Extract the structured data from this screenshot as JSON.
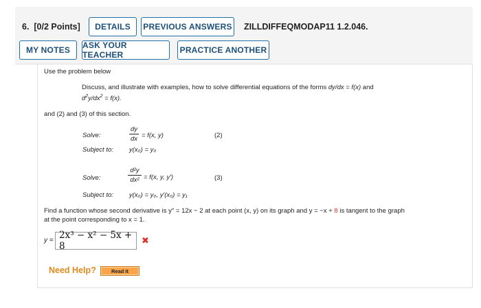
{
  "header": {
    "question_number": "6.",
    "points": "[0/2 Points]",
    "details_label": "DETAILS",
    "previous_answers_label": "PREVIOUS ANSWERS",
    "question_id": "ZILLDIFFEQMODAP11 1.2.046.",
    "my_notes_label": "MY NOTES",
    "ask_teacher_label": "ASK YOUR TEACHER",
    "practice_another_label": "PRACTICE ANOTHER"
  },
  "problem": {
    "intro": "Use the problem below",
    "discuss_text": "Discuss, and illustrate with examples, how to solve differential equations of the forms",
    "form1": "dy/dx = f(x)",
    "and_word": "and",
    "form2_prefix": "d",
    "form2_rest": "y/dx",
    "form2_end": " = f(x).",
    "and_section": "and (2) and (3) of this section.",
    "solve_label": "Solve:",
    "subject_label": "Subject to:",
    "eq2_num": "dy",
    "eq2_den": "dx",
    "eq2_rhs": "= f(x, y)",
    "eq2_tag": "(2)",
    "eq2_cond": "y(x₀) = y₀",
    "eq3_num": "d²y",
    "eq3_den": "dx²",
    "eq3_rhs": "= f(x, y, y′)",
    "eq3_tag": "(3)",
    "eq3_cond": "y(x₀) = y₀, y′(x₀) = y₁",
    "task_part1": "Find a function whose second derivative is y″ = 12x − 2 at each point (x, y) on its graph and y = −x +",
    "task_highlight": "8",
    "task_part2": "is tangent to the graph",
    "task_line2": "at the point corresponding to x = 1."
  },
  "answer": {
    "label": "y =",
    "value": "2x³ − x² − 5x + 8",
    "status": "incorrect",
    "status_icon": "x-mark-icon"
  },
  "help": {
    "need_help_label": "Need Help?",
    "read_it_label": "Read It"
  },
  "colors": {
    "button_border": "#1e6fa8",
    "button_text": "#1b4f7a",
    "incorrect": "#e0302a",
    "need_help": "#e08a1b",
    "read_it_bg": "#f8a54a"
  }
}
